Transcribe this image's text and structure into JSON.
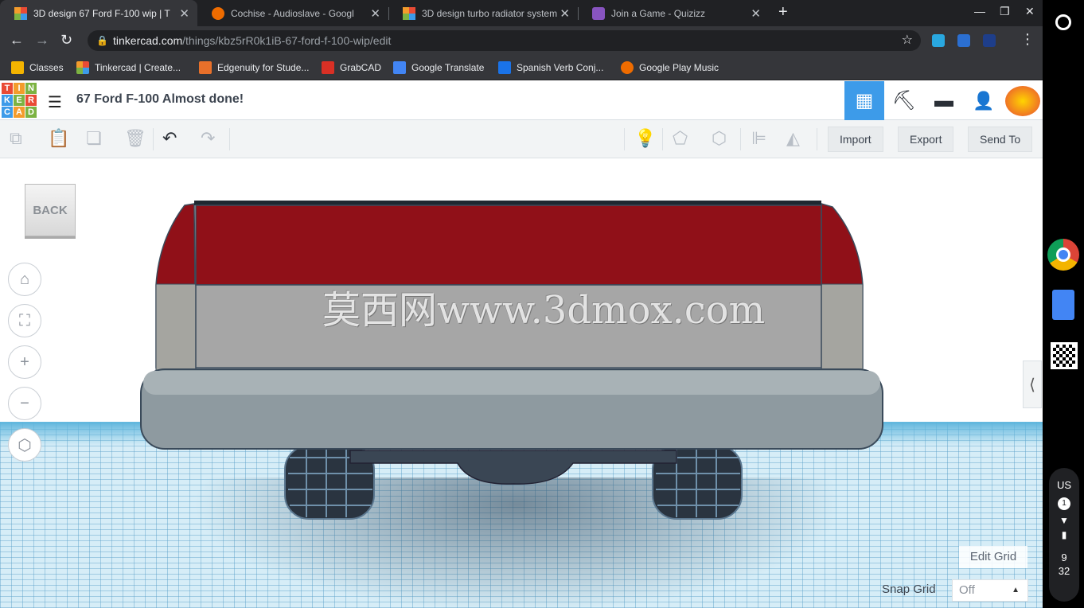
{
  "browser": {
    "tabs": [
      {
        "title": "3D design 67 Ford F-100 wip | Ti",
        "favicon": "tinkercad-grid-icon",
        "active": true
      },
      {
        "title": "Cochise - Audioslave - Googl",
        "favicon": "play-music-icon",
        "active": false
      },
      {
        "title": "3D design turbo radiator system",
        "favicon": "tinkercad-grid-icon",
        "active": false
      },
      {
        "title": "Join a Game - Quizizz",
        "favicon": "quizizz-icon",
        "active": false
      }
    ],
    "new_tab": "+",
    "url_host": "tinkercad.com",
    "url_path": "/things/kbz5rR0k1iB-67-ford-f-100-wip/edit",
    "bookmarks": [
      {
        "label": "Classes",
        "color": "#f4b400"
      },
      {
        "label": "Tinkercad | Create...",
        "color": "#e94b35"
      },
      {
        "label": "Edgenuity for Stude...",
        "color": "#e8702a"
      },
      {
        "label": "GrabCAD",
        "color": "#d93025"
      },
      {
        "label": "Google Translate",
        "color": "#4285f4"
      },
      {
        "label": "Spanish Verb Conj...",
        "color": "#1a73e8"
      },
      {
        "label": "Google Play Music",
        "color": "#ef6c00"
      }
    ]
  },
  "tinkercad": {
    "logo_letters": [
      "T",
      "I",
      "N",
      "K",
      "E",
      "R",
      "C",
      "A",
      "D"
    ],
    "logo_colors": [
      "#e94b35",
      "#f39c2c",
      "#7cb342",
      "#3d9be9",
      "#7cb342",
      "#e94b35",
      "#3d9be9",
      "#f39c2c",
      "#7cb342"
    ],
    "design_title": "67 Ford F-100 Almost done!",
    "toolbar": {
      "import": "Import",
      "export": "Export",
      "send_to": "Send To"
    },
    "viewcube_label": "BACK",
    "edit_grid": "Edit Grid",
    "snap_grid_label": "Snap Grid",
    "snap_grid_value": "Off",
    "watermark": "莫西网www.3dmox.com",
    "colors": {
      "accent": "#3d9be9",
      "truck_red": "#901018",
      "truck_grey": "#a6a6a6",
      "grid": "#d6edf7"
    }
  },
  "os_tray": {
    "keyboard": "US",
    "notifications": "1",
    "time_hour": "9",
    "time_min": "32"
  }
}
